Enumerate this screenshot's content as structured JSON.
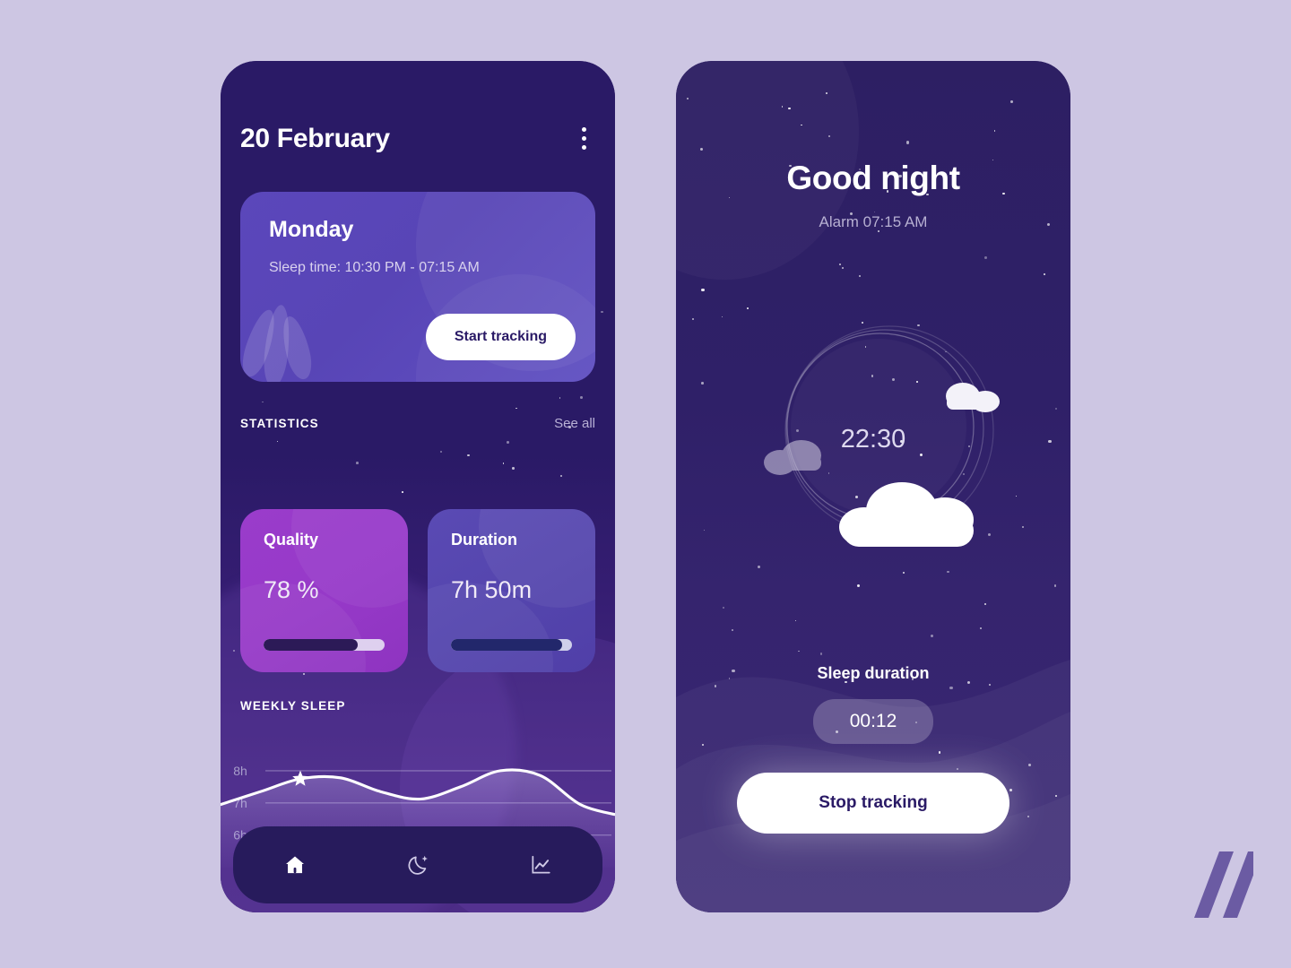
{
  "background_color": "#cdc6e3",
  "home_screen": {
    "date_title": "20 February",
    "menu_icon": "more-vertical-icon",
    "day_card": {
      "day": "Monday",
      "sleep_time": "Sleep time: 10:30 PM - 07:15 AM",
      "action_label": "Start tracking"
    },
    "statistics": {
      "section_title": "STATISTICS",
      "see_all": "See all",
      "cards": [
        {
          "label": "Quality",
          "value": "78 %",
          "progress": 78,
          "color": "#9639c8"
        },
        {
          "label": "Duration",
          "value": "7h 50m",
          "progress": 92,
          "color": "#5445ad"
        }
      ]
    },
    "weekly": {
      "section_title": "WEEKLY SLEEP"
    },
    "nav": [
      {
        "name": "home",
        "icon": "home-icon",
        "active": true
      },
      {
        "name": "sleep",
        "icon": "moon-sparkle-icon",
        "active": false
      },
      {
        "name": "stats",
        "icon": "line-chart-icon",
        "active": false
      }
    ]
  },
  "night_screen": {
    "title": "Good night",
    "alarm": "Alarm 07:15 AM",
    "clock": "22:30",
    "duration_label": "Sleep duration",
    "duration_value": "00:12",
    "action_label": "Stop tracking",
    "illustration": "crescent-moon-with-clouds"
  },
  "watermark": {
    "logo": "double-slash-logo",
    "color": "#6b5ba3"
  },
  "chart_data": {
    "type": "line",
    "title": "WEEKLY SLEEP",
    "ylabel": "",
    "xlabel": "",
    "ylim": [
      5.6,
      8.5
    ],
    "grid": true,
    "tick_labels": [
      "8h",
      "7h",
      "6h"
    ],
    "tick_values": [
      8,
      7,
      6
    ],
    "legend": null,
    "marker": {
      "x_index": 2,
      "value": 7.75,
      "shape": "star"
    },
    "x": [
      0,
      1,
      2,
      3,
      4,
      5,
      6,
      7,
      8,
      9,
      10
    ],
    "values": [
      6.95,
      7.35,
      7.75,
      7.78,
      7.35,
      7.12,
      7.5,
      8.0,
      7.85,
      6.95,
      6.6
    ]
  }
}
